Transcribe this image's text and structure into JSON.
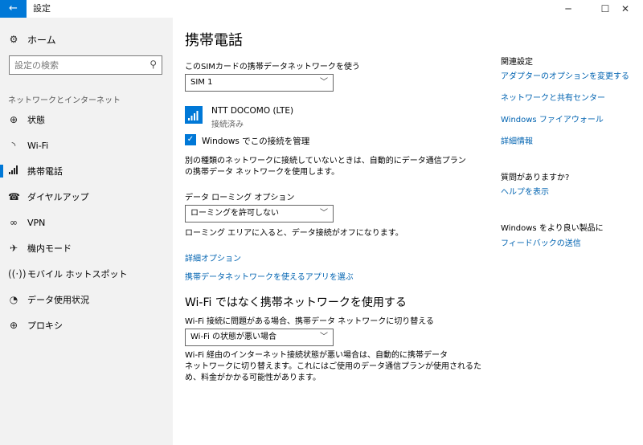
{
  "window": {
    "title": "設定",
    "back_icon": "←",
    "minimize_icon": "─",
    "maximize_icon": "☐",
    "close_icon": "✕"
  },
  "sidebar": {
    "home_label": "ホーム",
    "search_placeholder": "設定の検索",
    "section_heading": "ネットワークとインターネット",
    "items": [
      {
        "label": "状態",
        "icon": "globe-icon",
        "selected": false
      },
      {
        "label": "Wi-Fi",
        "icon": "wifi-icon",
        "selected": false
      },
      {
        "label": "携帯電話",
        "icon": "cellular-icon",
        "selected": true
      },
      {
        "label": "ダイヤルアップ",
        "icon": "dialup-icon",
        "selected": false
      },
      {
        "label": "VPN",
        "icon": "vpn-icon",
        "selected": false
      },
      {
        "label": "機内モード",
        "icon": "airplane-icon",
        "selected": false
      },
      {
        "label": "モバイル ホットスポット",
        "icon": "hotspot-icon",
        "selected": false
      },
      {
        "label": "データ使用状況",
        "icon": "data-usage-icon",
        "selected": false
      },
      {
        "label": "プロキシ",
        "icon": "proxy-globe-icon",
        "selected": false
      }
    ]
  },
  "main": {
    "title": "携帯電話",
    "sim_label": "このSIMカードの携帯データネットワークを使う",
    "sim_value": "SIM 1",
    "carrier_name": "NTT DOCOMO (LTE)",
    "carrier_status": "接続済み",
    "manage_checked": true,
    "manage_label": "Windows でこの接続を管理",
    "manage_desc_line1": "別の種類のネットワークに接続していないときは、自動的にデータ通信プラン",
    "manage_desc_line2": "の携帯データ ネットワークを使用します。",
    "roaming_label": "データ ローミング オプション",
    "roaming_value": "ローミングを許可しない",
    "roaming_desc": "ローミング エリアに入ると、データ接続がオフになります。",
    "advanced_link": "詳細オプション",
    "apps_link": "携帯データネットワークを使えるアプリを選ぶ",
    "wifi_section_title": "Wi-Fi ではなく携帯ネットワークを使用する",
    "wifi_switch_label": "Wi-Fi 接続に問題がある場合、携帯データ ネットワークに切り替える",
    "wifi_switch_value": "Wi-Fi の状態が悪い場合",
    "wifi_desc_line1": "Wi-Fi 経由のインターネット接続状態が悪い場合は、自動的に携帯データ",
    "wifi_desc_line2": "ネットワークに切り替えます。これにはご使用のデータ通信プランが使用されるた",
    "wifi_desc_line3": "め、料金がかかる可能性があります。"
  },
  "related": {
    "heading": "関連設定",
    "links": [
      "アダプターのオプションを変更する",
      "ネットワークと共有センター",
      "Windows ファイアウォール",
      "詳細情報"
    ],
    "question_heading": "質問がありますか?",
    "help_link": "ヘルプを表示",
    "improve_heading": "Windows をより良い製品に",
    "feedback_link": "フィードバックの送信"
  },
  "colors": {
    "accent": "#0078d7",
    "link": "#0063b1",
    "sidebar_bg": "#f2f2f2"
  }
}
